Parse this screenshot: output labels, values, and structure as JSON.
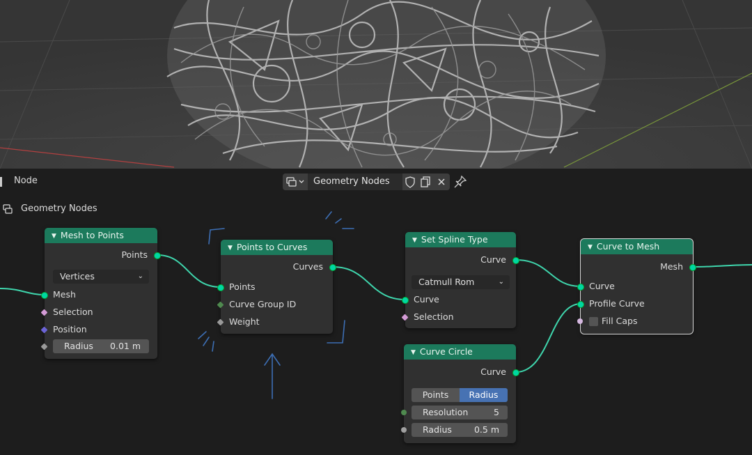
{
  "header": {
    "menu_node": "Node",
    "tree_name": "Geometry Nodes"
  },
  "breadcrumb": {
    "label": "Geometry Nodes"
  },
  "nodes": {
    "mesh_to_points": {
      "title": "Mesh to Points",
      "output_points": "Points",
      "mode_value": "Vertices",
      "input_mesh": "Mesh",
      "input_selection": "Selection",
      "input_position": "Position",
      "radius_label": "Radius",
      "radius_value": "0.01 m"
    },
    "points_to_curves": {
      "title": "Points to Curves",
      "output_curves": "Curves",
      "input_points": "Points",
      "input_group_id": "Curve Group ID",
      "input_weight": "Weight"
    },
    "set_spline_type": {
      "title": "Set Spline Type",
      "output_curve": "Curve",
      "type_value": "Catmull Rom",
      "input_curve": "Curve",
      "input_selection": "Selection"
    },
    "curve_circle": {
      "title": "Curve Circle",
      "output_curve": "Curve",
      "mode_points": "Points",
      "mode_radius": "Radius",
      "resolution_label": "Resolution",
      "resolution_value": "5",
      "radius_label": "Radius",
      "radius_value": "0.5 m"
    },
    "curve_to_mesh": {
      "title": "Curve to Mesh",
      "output_mesh": "Mesh",
      "input_curve": "Curve",
      "input_profile": "Profile Curve",
      "fill_caps": "Fill Caps"
    }
  },
  "colors": {
    "node_header": "#1c7a5c",
    "geometry_socket": "#00d6a3",
    "selected_mode": "#4772b3",
    "annotation": "#3d6fb5"
  }
}
